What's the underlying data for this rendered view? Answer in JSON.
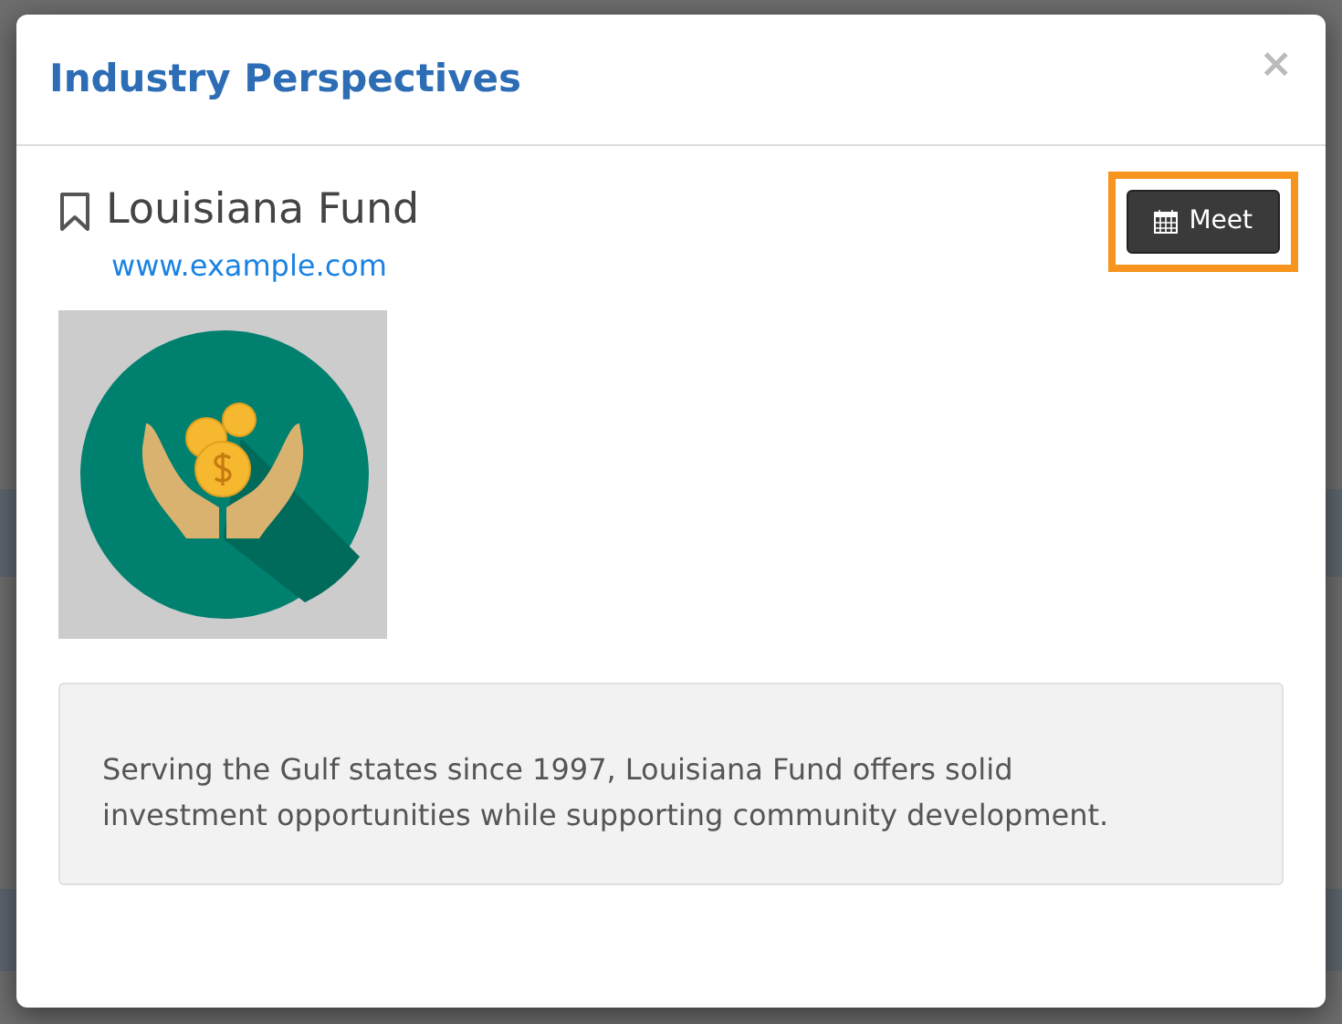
{
  "modal": {
    "title": "Industry Perspectives",
    "close": "×"
  },
  "listing": {
    "name": "Louisiana Fund",
    "bookmarked": false,
    "website": "www.example.com",
    "description": "Serving the Gulf states since 1997, Louisiana Fund offers solid investment opportunities while supporting community development."
  },
  "meet_button": {
    "label": "Meet",
    "highlighted": true
  }
}
